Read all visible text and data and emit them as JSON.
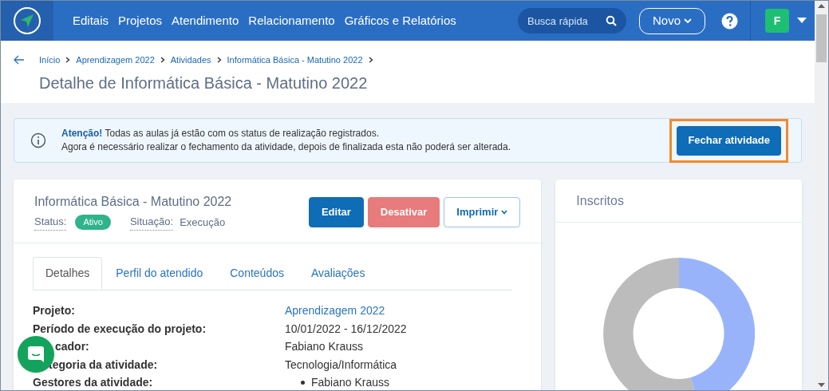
{
  "nav": {
    "items": [
      "Editais",
      "Projetos",
      "Atendimento",
      "Relacionamento",
      "Gráficos e Relatórios"
    ],
    "search": {
      "placeholder": "Busca rápida"
    },
    "new_button": "Novo",
    "avatar": "F"
  },
  "breadcrumb": [
    "Início",
    "Aprendizagem 2022",
    "Atividades",
    "Informática Básica - Matutino 2022"
  ],
  "page_title": "Detalhe de Informática Básica - Matutino 2022",
  "alert": {
    "text": "**Atenção!** Todas as aulas já estão com os status de realização registrados.",
    "text_2": "Agora é necessário realizar o fechamento da atividade, depois de finalizada esta não poderá ser alterada.",
    "button": "Fechar atividade",
    "highlighted": true
  },
  "activity": {
    "title": "Informática Básica - Matutino 2022",
    "status_label": "Status:",
    "status": "Ativo",
    "situation_label": "Situação:",
    "situation": "Execução",
    "buttons": [
      {
        "label": "Editar",
        "kind": "primary"
      },
      {
        "label": "Desativar",
        "kind": "danger"
      },
      {
        "label": "Imprimir",
        "kind": "dropdown"
      }
    ]
  },
  "tabs": [
    {
      "label": "Detalhes",
      "selected": true
    },
    {
      "label": "Perfil do atendido",
      "selected": false
    },
    {
      "label": "Conteúdos",
      "selected": false
    },
    {
      "label": "Avaliações",
      "selected": false
    }
  ],
  "details": [
    {
      "label": "Projeto:",
      "value": "Aprendizagem 2022",
      "kind": "link"
    },
    {
      "label": "Período de execução do projeto:",
      "value": "10/01/2022 - 16/12/2022",
      "kind": "text"
    },
    {
      "label": "cador:",
      "value": "Fabiano Krauss",
      "kind": "text"
    },
    {
      "label": "tegoria da atividade:",
      "value": "Tecnologia/Informática",
      "kind": "text"
    },
    {
      "label": "Gestores da atividade:",
      "value": "Fabiano Krauss",
      "kind": "list"
    }
  ],
  "side_card": {
    "title": "Inscritos"
  }
}
